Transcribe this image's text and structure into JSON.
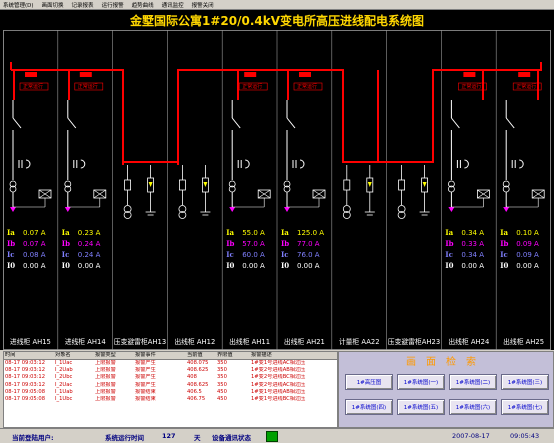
{
  "menu": [
    "系统管理(D)",
    "画面切换",
    "记录报表",
    "运行报警",
    "趋势曲线",
    "通讯监控",
    "报警关闭"
  ],
  "title": "金墅国际公寓1#20/0.4kV变电所高压进线配电系统图",
  "status_label": "正常运行",
  "cabinets": [
    {
      "name": "进线柜 AH15",
      "vals": {
        "Ia": "0.07 A",
        "Ib": "0.07 A",
        "Ic": "0.08 A",
        "I0": "0.00 A"
      }
    },
    {
      "name": "进线柜 AH14",
      "vals": {
        "Ia": "0.23 A",
        "Ib": "0.24 A",
        "Ic": "0.24 A",
        "I0": "0.00 A"
      }
    },
    {
      "name": "压变避雷柜AH13"
    },
    {
      "name": "出线柜 AH12"
    },
    {
      "name": "出线柜 AH11",
      "vals": {
        "Ia": "55.0 A",
        "Ib": "57.0 A",
        "Ic": "60.0 A",
        "I0": "0.00 A"
      }
    },
    {
      "name": "出线柜 AH21",
      "vals": {
        "Ia": "125.0 A",
        "Ib": "77.0 A",
        "Ic": "76.0 A",
        "I0": "0.00 A"
      }
    },
    {
      "name": "计量柜 AA22"
    },
    {
      "name": "压变避雷柜AH23"
    },
    {
      "name": "出线柜 AH24",
      "vals": {
        "Ia": "0.34 A",
        "Ib": "0.33 A",
        "Ic": "0.34 A",
        "I0": "0.00 A"
      }
    },
    {
      "name": "出线柜 AH25",
      "vals": {
        "Ia": "0.10 A",
        "Ib": "0.09 A",
        "Ic": "0.09 A",
        "I0": "0.00 A"
      }
    }
  ],
  "alarm_headers": [
    "时间",
    "对象名",
    "报警类型",
    "报警事件",
    "当前值",
    "界限值",
    "报警描述"
  ],
  "alarm_rows": [
    [
      "08-17 09:03:12",
      "I_1Uac",
      "上限报警",
      "报警产生",
      "408.075",
      "350",
      "1#变1号进线AC相过压"
    ],
    [
      "08-17 09:03:12",
      "I_2Uab",
      "上限报警",
      "报警产生",
      "408.625",
      "350",
      "1#变2号进线AB相过压"
    ],
    [
      "08-17 09:03:12",
      "I_2Ubc",
      "上限报警",
      "报警产生",
      "408",
      "350",
      "1#变2号进线BC相过压"
    ],
    [
      "08-17 09:03:12",
      "I_2Uac",
      "上限报警",
      "报警产生",
      "408.625",
      "350",
      "1#变2号进线AC相过压"
    ],
    [
      "08-17 09:05:08",
      "I_1Uab",
      "上限报警",
      "报警结束",
      "406.5",
      "450",
      "1#变1号进线AB相过压"
    ],
    [
      "08-17 09:05:08",
      "I_1Ubc",
      "上限报警",
      "报警结束",
      "406.75",
      "450",
      "1#变1号进线BC相过压"
    ]
  ],
  "panel_title": "画面检索",
  "nav_buttons": [
    "1#高压图",
    "1#系统图(一)",
    "1#系统图(二)",
    "1#系统图(三)",
    "1#系统图(四)",
    "1#系统图(五)",
    "1#系统图(六)",
    "1#系统图(七)"
  ],
  "statusbar": {
    "user_label": "当前登陆用户:",
    "runtime_label": "系统运行时间",
    "runtime_value": "127",
    "runtime_unit": "天",
    "comm_label": "设备通讯状态",
    "datetime": "2007-08-17",
    "time": "09:05:43"
  },
  "colors": {
    "bus": "#ff0000",
    "title": "#ffd700",
    "running": "#ff0000",
    "Ia": "#ffff00",
    "Ib": "#ff00ff",
    "Ic": "#8080ff",
    "I0": "#ffffff",
    "alarm_text": "#cc0000"
  }
}
